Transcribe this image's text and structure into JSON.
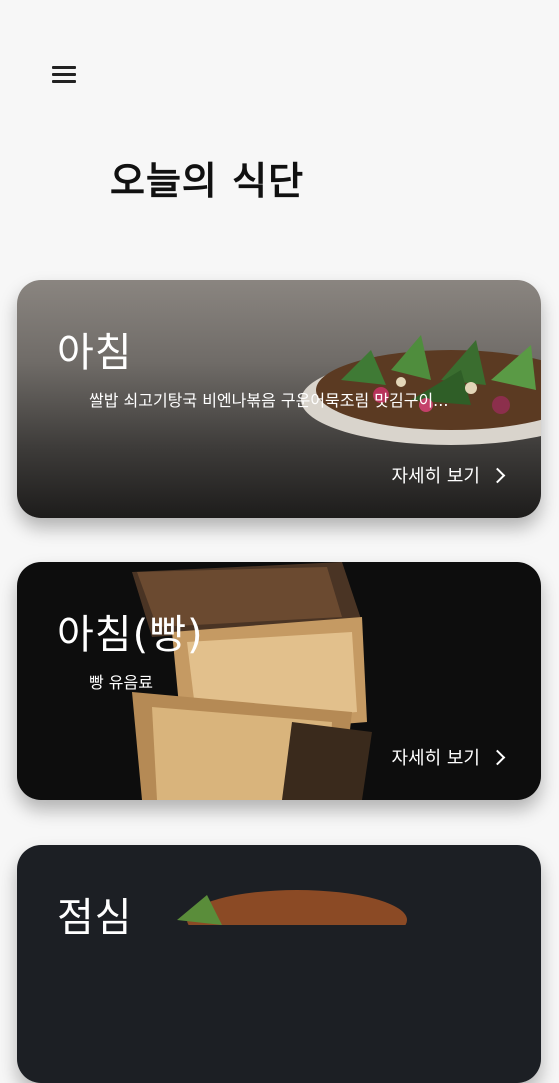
{
  "header": {
    "title": "오늘의 식단"
  },
  "cards": [
    {
      "meal": "아침",
      "menu": "쌀밥 쇠고기탕국 비엔나볶음 구운어묵조림 맛김구이...",
      "detail_label": "자세히 보기"
    },
    {
      "meal": "아침(빵)",
      "menu": "빵 유음료",
      "detail_label": "자세히 보기"
    },
    {
      "meal": "점심"
    }
  ],
  "icons": {
    "menu": "hamburger-menu-icon",
    "detail": "chevron-right-icon"
  }
}
